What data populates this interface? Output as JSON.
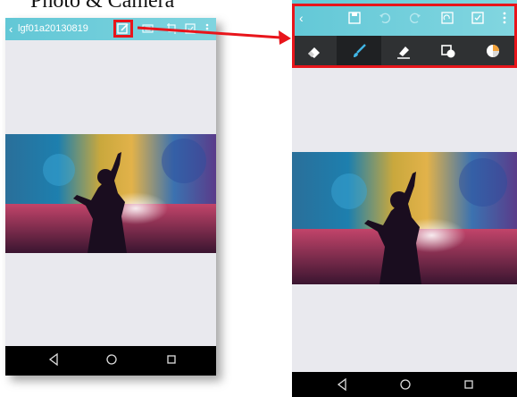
{
  "caption": "Photo  &  Camera",
  "left_screen": {
    "title": "lgf01a20130819",
    "icons": [
      "back-icon",
      "edit-icon",
      "crop-icon",
      "export-icon",
      "more-vert-icon"
    ]
  },
  "right_screen": {
    "top_icons": [
      "back-icon",
      "save-icon",
      "undo-icon",
      "redo-icon",
      "rotate-icon",
      "export-icon",
      "more-vert-icon"
    ],
    "tool_icons": [
      "eraser-icon",
      "brush-icon",
      "highlighter-icon",
      "shape-icon",
      "color-palette-icon"
    ],
    "active_tool": "brush"
  },
  "nav_icons": [
    "back-triangle-icon",
    "home-circle-icon",
    "recents-square-icon"
  ],
  "colors": {
    "accent": "#6fcbd9",
    "highlight": "#e8151b",
    "toolbar_dark": "#2f3133",
    "canvas": "#e9e9ee"
  }
}
